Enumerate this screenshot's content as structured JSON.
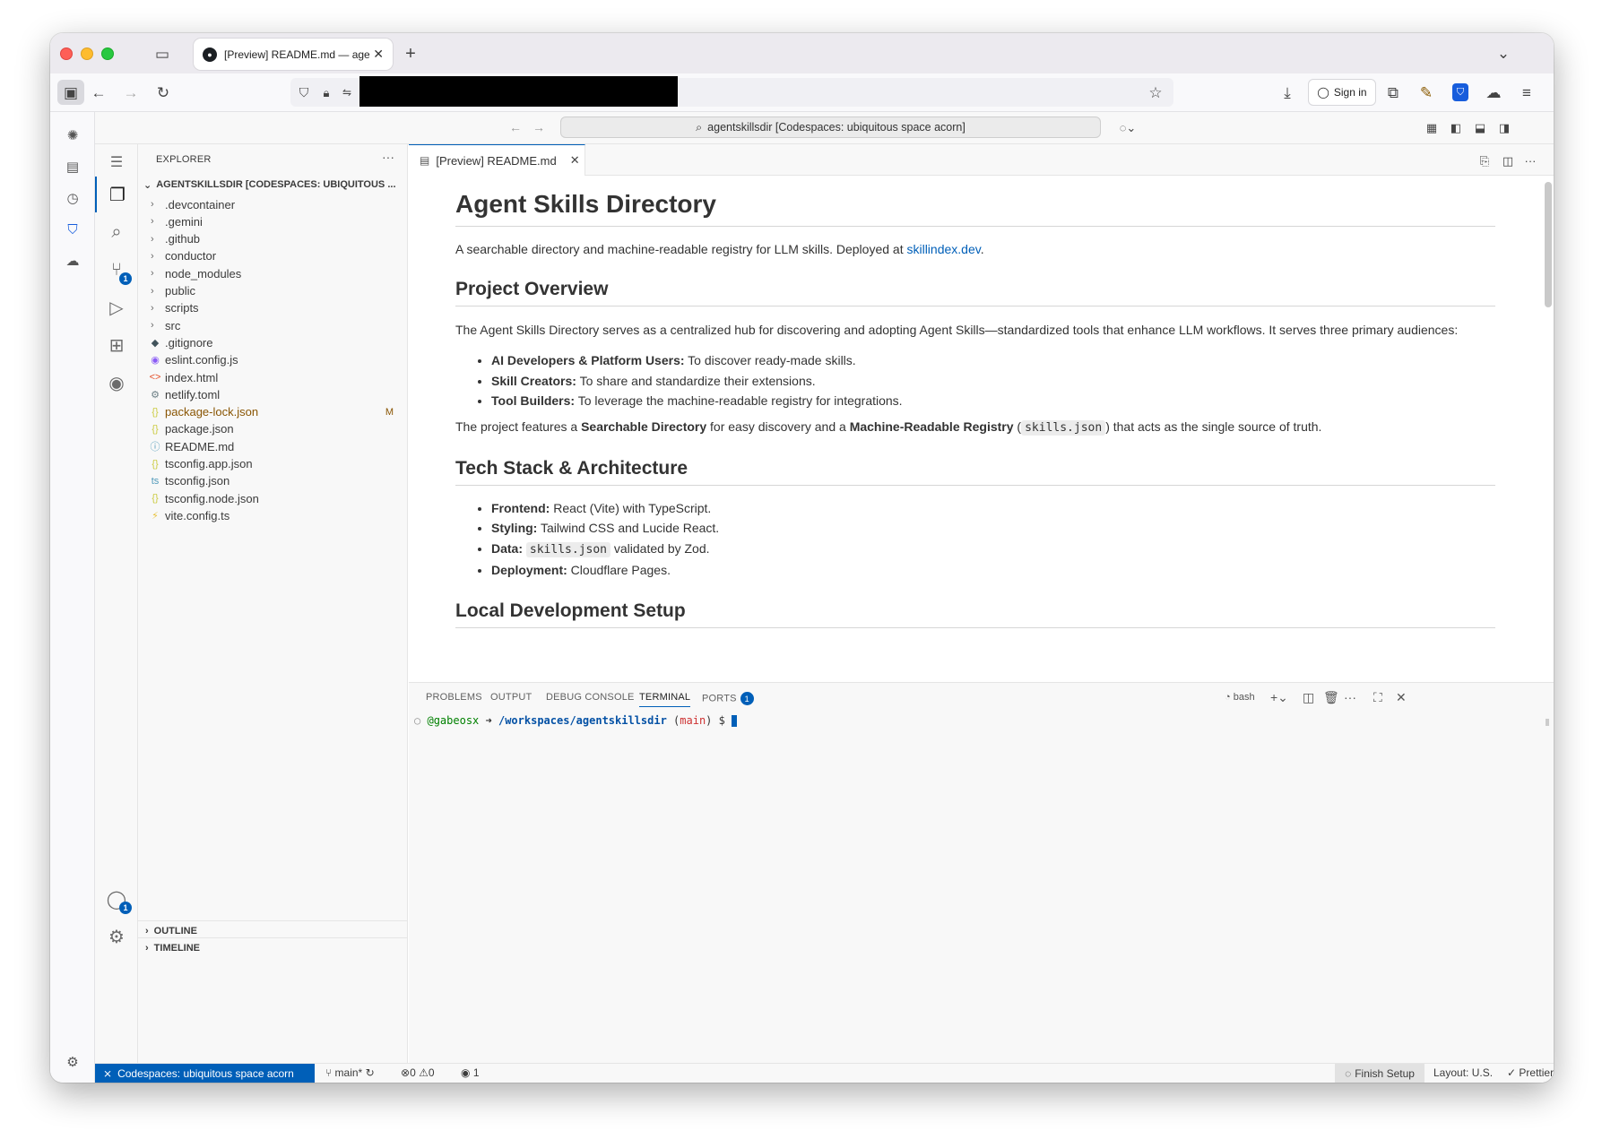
{
  "browser": {
    "tab_title": "[Preview] README.md — agent:",
    "sign_in": "Sign in"
  },
  "vscode": {
    "command_center": "agentskillsdir [Codespaces: ubiquitous space acorn]",
    "explorer": {
      "title": "EXPLORER",
      "folder": "AGENTSKILLSDIR [CODESPACES: UBIQUITOUS ...",
      "items": [
        {
          "label": ".devcontainer",
          "type": "folder"
        },
        {
          "label": ".gemini",
          "type": "folder"
        },
        {
          "label": ".github",
          "type": "folder"
        },
        {
          "label": "conductor",
          "type": "folder"
        },
        {
          "label": "node_modules",
          "type": "folder"
        },
        {
          "label": "public",
          "type": "folder"
        },
        {
          "label": "scripts",
          "type": "folder"
        },
        {
          "label": "src",
          "type": "folder"
        },
        {
          "label": ".gitignore",
          "type": "file",
          "icon": "◆",
          "color": "#41535b"
        },
        {
          "label": "eslint.config.js",
          "type": "file",
          "icon": "◉",
          "color": "#8b5cf6"
        },
        {
          "label": "index.html",
          "type": "file",
          "icon": "<>",
          "color": "#e44d26"
        },
        {
          "label": "netlify.toml",
          "type": "file",
          "icon": "⚙",
          "color": "#6d8086"
        },
        {
          "label": "package-lock.json",
          "type": "file",
          "icon": "{}",
          "color": "#cbcb41",
          "modified": "M"
        },
        {
          "label": "package.json",
          "type": "file",
          "icon": "{}",
          "color": "#cbcb41"
        },
        {
          "label": "README.md",
          "type": "file",
          "icon": "ⓘ",
          "color": "#519aba"
        },
        {
          "label": "tsconfig.app.json",
          "type": "file",
          "icon": "{}",
          "color": "#cbcb41"
        },
        {
          "label": "tsconfig.json",
          "type": "file",
          "icon": "ts",
          "color": "#519aba"
        },
        {
          "label": "tsconfig.node.json",
          "type": "file",
          "icon": "{}",
          "color": "#cbcb41"
        },
        {
          "label": "vite.config.ts",
          "type": "file",
          "icon": "⚡",
          "color": "#e8c23a"
        }
      ],
      "outline": "OUTLINE",
      "timeline": "TIMELINE"
    },
    "editor_tab": "[Preview] README.md",
    "readme": {
      "h1": "Agent Skills Directory",
      "intro_text": "A searchable directory and machine-readable registry for LLM skills. Deployed at",
      "intro_link": "skillindex.dev",
      "h2_overview": "Project Overview",
      "overview_text": "The Agent Skills Directory serves as a centralized hub for discovering and adopting Agent Skills—standardized tools that enhance LLM workflows. It serves three primary audiences:",
      "audiences": [
        {
          "bold": "AI Developers & Platform Users:",
          "text": " To discover ready-made skills."
        },
        {
          "bold": "Skill Creators:",
          "text": " To share and standardize their extensions."
        },
        {
          "bold": "Tool Builders:",
          "text": " To leverage the machine-readable registry for integrations."
        }
      ],
      "features": {
        "pre": "The project features a ",
        "b1": "Searchable Directory",
        "mid": " for easy discovery and a ",
        "b2": "Machine-Readable Registry",
        "code": "skills.json",
        "post": " that acts as the single source of truth."
      },
      "h2_stack": "Tech Stack & Architecture",
      "stack": {
        "frontend_b": "Frontend:",
        "frontend_t": " React (Vite) with TypeScript.",
        "styling_b": "Styling:",
        "styling_t": " Tailwind CSS and Lucide React.",
        "data_b": "Data:",
        "data_code": "skills.json",
        "data_t": " validated by Zod.",
        "deploy_b": "Deployment:",
        "deploy_t": " Cloudflare Pages."
      },
      "h2_local": "Local Development Setup"
    },
    "panel": {
      "tabs": [
        "PROBLEMS",
        "OUTPUT",
        "DEBUG CONSOLE",
        "TERMINAL",
        "PORTS"
      ],
      "ports_count": "1",
      "shell": "bash",
      "prompt_user": "@gabeosx",
      "prompt_arrow": "➜",
      "prompt_path": "/workspaces/agentskillsdir",
      "prompt_branch": "main",
      "prompt_symbol": "$"
    },
    "status": {
      "remote": "Codespaces: ubiquitous space acorn",
      "branch": "main*",
      "errors": "0",
      "warnings": "0",
      "ports": "1",
      "finish_setup": "Finish Setup",
      "layout": "Layout: U.S.",
      "prettier": "Prettier"
    },
    "badges": {
      "scm": "1",
      "accounts": "1"
    }
  },
  "colors": {
    "accent": "#005fb8",
    "remote_bg": "#005fb8"
  }
}
